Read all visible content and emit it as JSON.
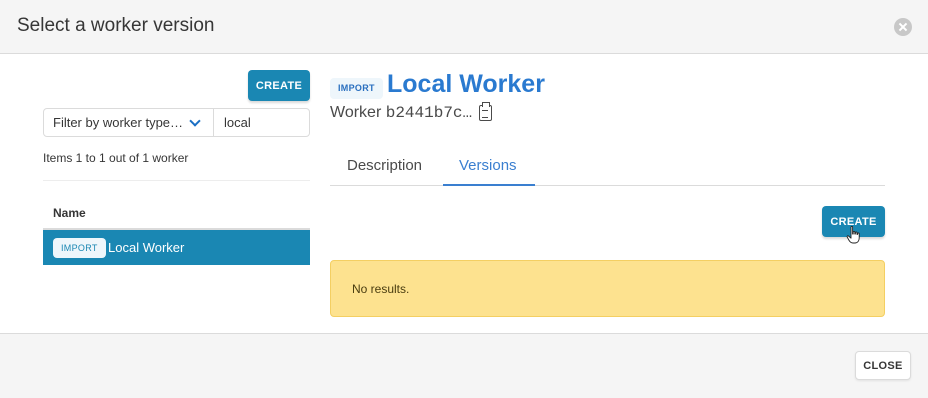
{
  "modal": {
    "title": "Select a worker version"
  },
  "left": {
    "create_label": "CREATE",
    "filter": {
      "selected": "Filter by worker type…"
    },
    "search": {
      "value": "local"
    },
    "pagination": "Items 1 to 1 out of 1 worker",
    "table": {
      "column_header": "Name",
      "rows": [
        {
          "tag": "IMPORT",
          "name": "Local Worker",
          "selected": true
        }
      ]
    }
  },
  "detail": {
    "tag": "IMPORT",
    "name": "Local Worker",
    "worker_prefix": "Worker",
    "worker_id": "b2441b7c…",
    "tabs": [
      {
        "label": "Description",
        "active": false
      },
      {
        "label": "Versions",
        "active": true
      }
    ],
    "versions": {
      "create_label": "CREATE",
      "empty_message": "No results."
    }
  },
  "footer": {
    "close_label": "CLOSE"
  },
  "colors": {
    "primary": "#1a87b3",
    "link": "#2a7ad0",
    "warning_bg": "#fde28f"
  }
}
